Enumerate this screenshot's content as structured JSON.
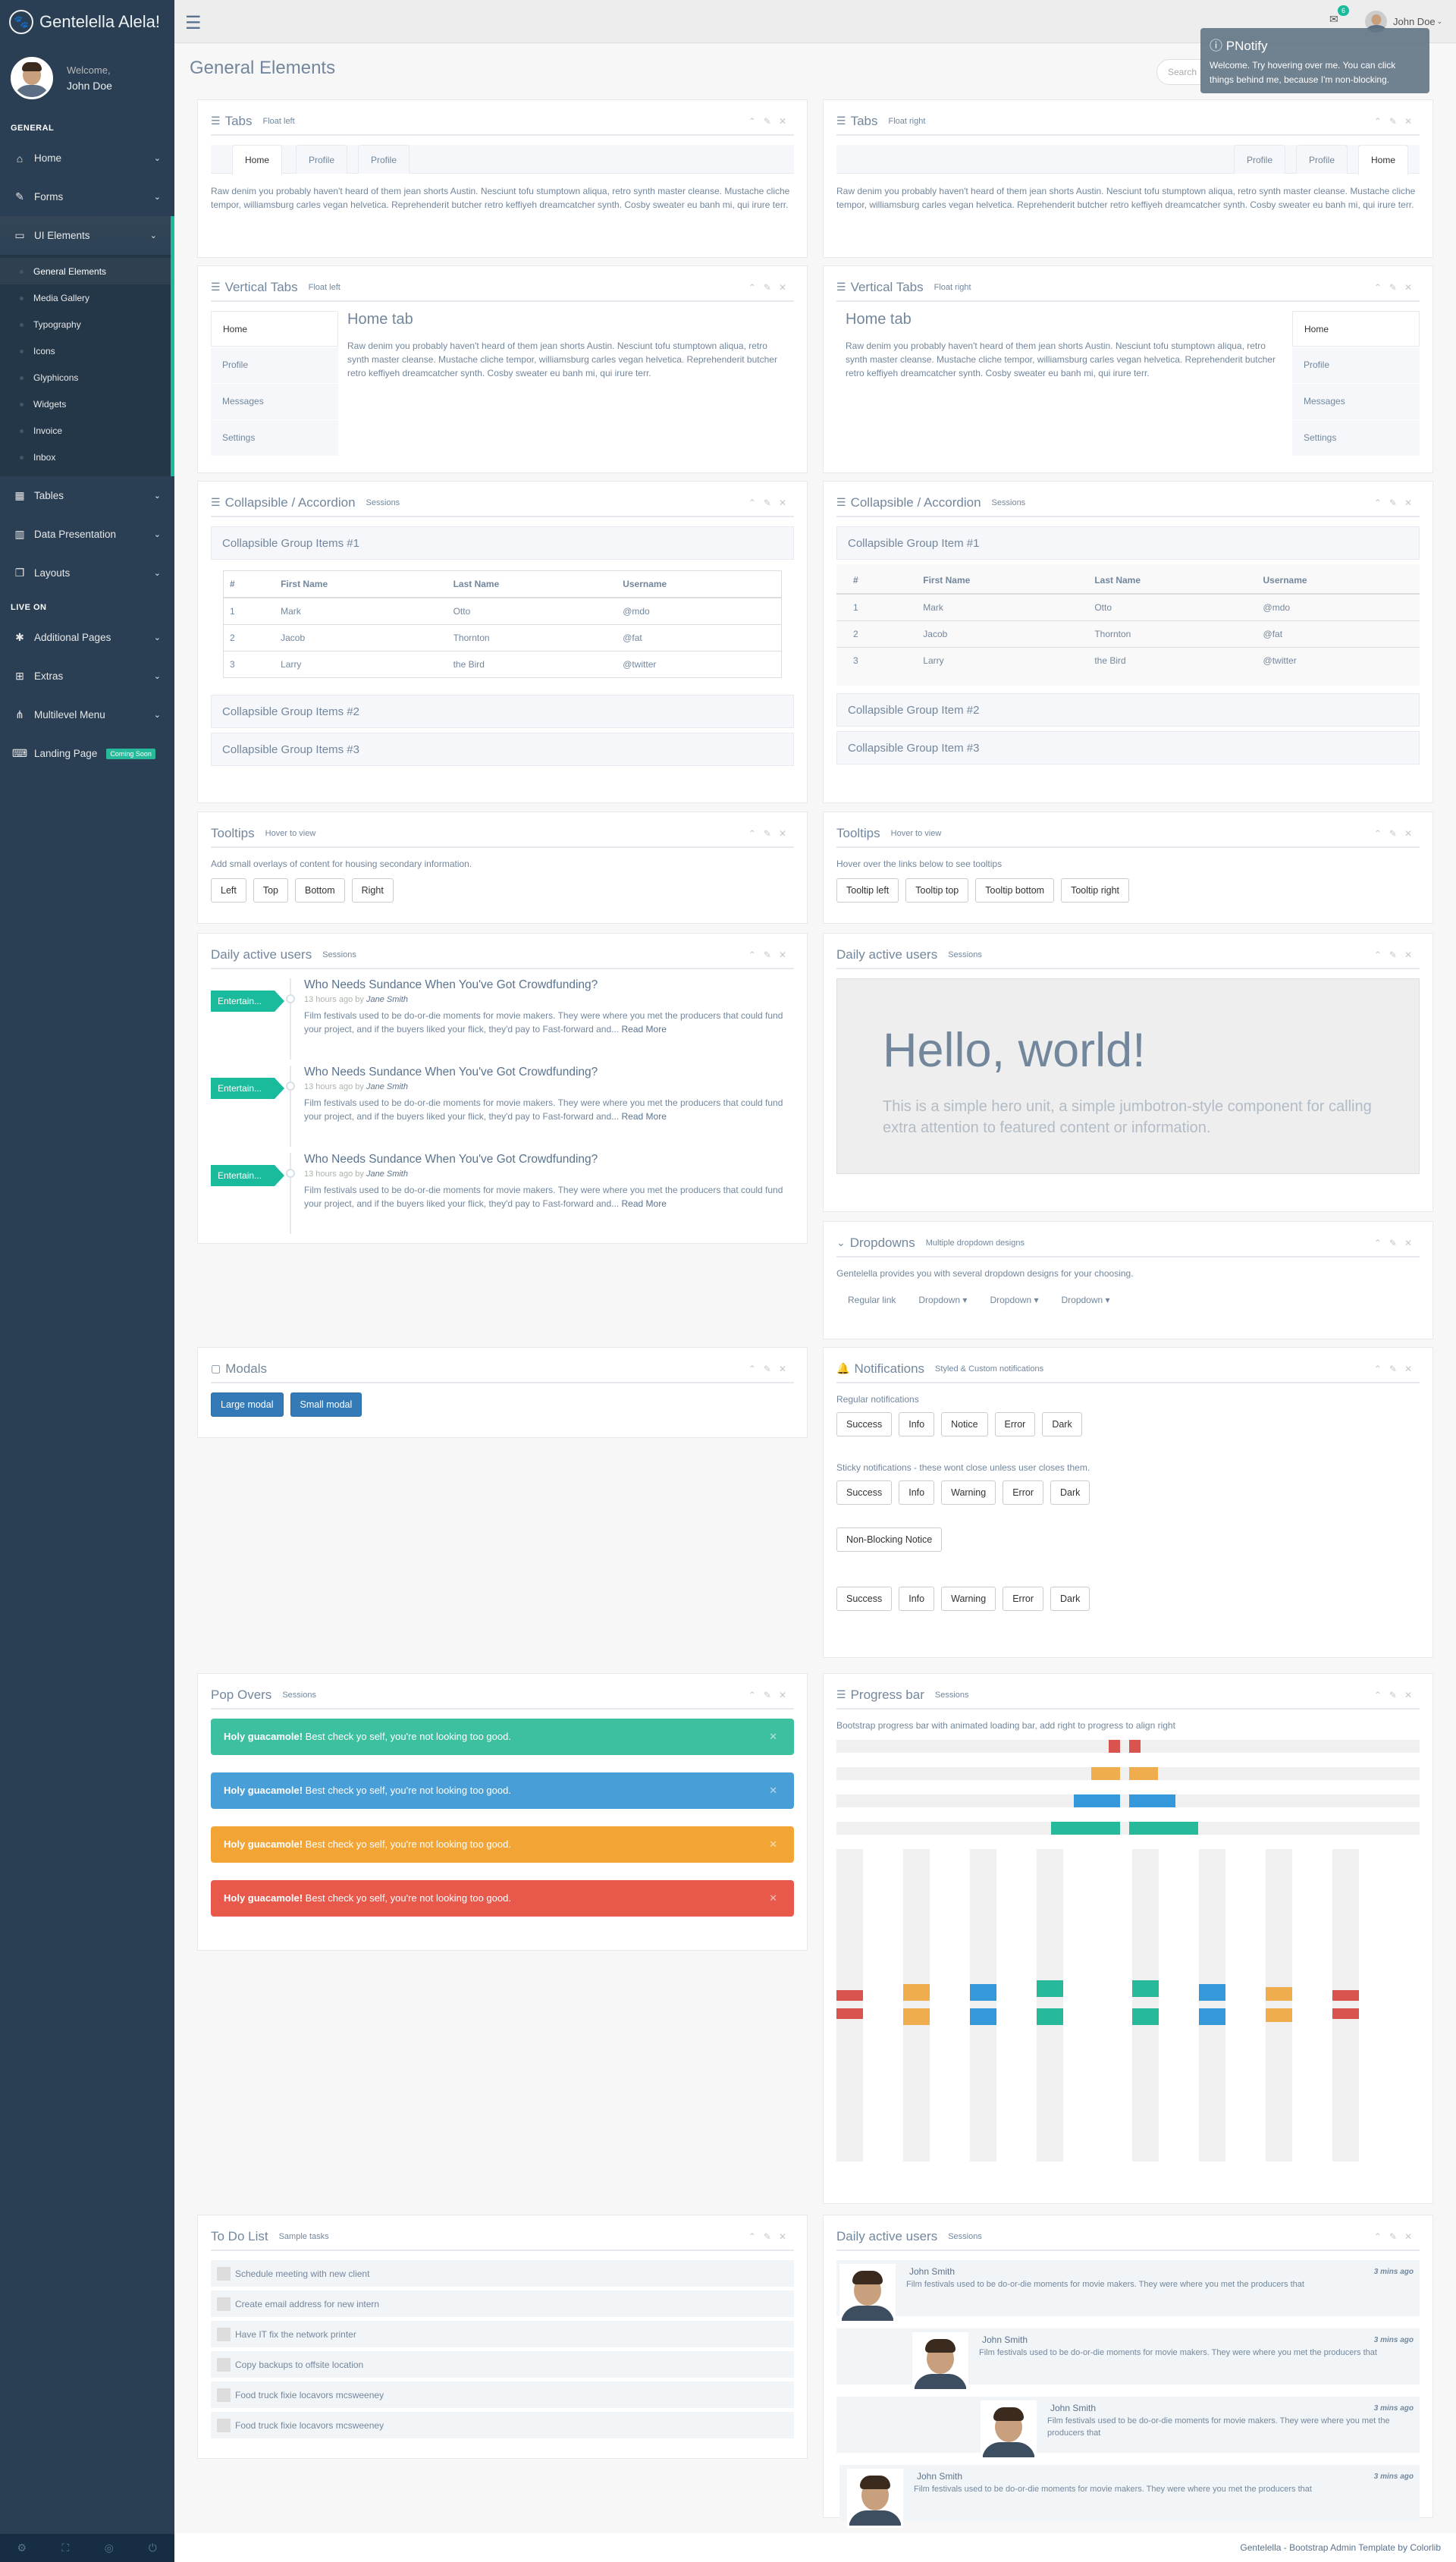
{
  "app": {
    "brand": "Gentelella Alela!",
    "page_title": "General Elements"
  },
  "sidebar": {
    "welcome": "Welcome,",
    "user_name": "John Doe",
    "section_general": "GENERAL",
    "section_live": "LIVE ON",
    "items": [
      {
        "label": "Home",
        "icon": "home-icon"
      },
      {
        "label": "Forms",
        "icon": "edit-icon"
      },
      {
        "label": "UI Elements",
        "icon": "desktop-icon"
      },
      {
        "label": "Tables",
        "icon": "table-icon"
      },
      {
        "label": "Data Presentation",
        "icon": "bar-chart-icon"
      },
      {
        "label": "Layouts",
        "icon": "clone-icon"
      },
      {
        "label": "Additional Pages",
        "icon": "bug-icon"
      },
      {
        "label": "Extras",
        "icon": "windows-icon"
      },
      {
        "label": "Multilevel Menu",
        "icon": "sitemap-icon"
      },
      {
        "label": "Landing Page",
        "icon": "laptop-icon"
      }
    ],
    "submenu": [
      "General Elements",
      "Media Gallery",
      "Typography",
      "Icons",
      "Glyphicons",
      "Widgets",
      "Invoice",
      "Inbox"
    ],
    "coming_soon": "Coming Soon"
  },
  "topnav": {
    "mail_count": "6",
    "user": "John Doe",
    "search_placeholder": "Search"
  },
  "pnotify": {
    "title": "PNotify",
    "body": "Welcome. Try hovering over me. You can click things behind me, because I'm non-blocking."
  },
  "lorem": "Raw denim you probably haven't heard of them jean shorts Austin. Nesciunt tofu stumptown aliqua, retro synth master cleanse. Mustache cliche tempor, williamsburg carles vegan helvetica. Reprehenderit butcher retro keffiyeh dreamcatcher synth. Cosby sweater eu banh mi, qui irure terr.",
  "tabs_left": {
    "title": "Tabs",
    "sub": "Float left",
    "tabs": [
      "Home",
      "Profile",
      "Profile"
    ]
  },
  "tabs_right": {
    "title": "Tabs",
    "sub": "Float right",
    "tabs": [
      "Profile",
      "Profile",
      "Home"
    ]
  },
  "vtabs_left": {
    "title": "Vertical Tabs",
    "sub": "Float left",
    "heading": "Home tab",
    "tabs": [
      "Home",
      "Profile",
      "Messages",
      "Settings"
    ]
  },
  "vtabs_right": {
    "title": "Vertical Tabs",
    "sub": "Float right",
    "heading": "Home tab",
    "tabs": [
      "Home",
      "Profile",
      "Messages",
      "Settings"
    ]
  },
  "acc_left": {
    "title": "Collapsible / Accordion",
    "sub": "Sessions",
    "groups": [
      "Collapsible Group Items #1",
      "Collapsible Group Items #2",
      "Collapsible Group Items #3"
    ]
  },
  "acc_right": {
    "title": "Collapsible / Accordion",
    "sub": "Sessions",
    "groups": [
      "Collapsible Group Item #1",
      "Collapsible Group Item #2",
      "Collapsible Group Item #3"
    ]
  },
  "table": {
    "headers": [
      "#",
      "First Name",
      "Last Name",
      "Username"
    ],
    "rows": [
      [
        "1",
        "Mark",
        "Otto",
        "@mdo"
      ],
      [
        "2",
        "Jacob",
        "Thornton",
        "@fat"
      ],
      [
        "3",
        "Larry",
        "the Bird",
        "@twitter"
      ]
    ]
  },
  "tooltips_left": {
    "title": "Tooltips",
    "sub": "Hover to view",
    "desc": "Add small overlays of content for housing secondary information.",
    "buttons": [
      "Left",
      "Top",
      "Bottom",
      "Right"
    ]
  },
  "tooltips_right": {
    "title": "Tooltips",
    "sub": "Hover to view",
    "desc": "Hover over the links below to see tooltips",
    "buttons": [
      "Tooltip left",
      "Tooltip top",
      "Tooltip bottom",
      "Tooltip right"
    ]
  },
  "timeline": {
    "title": "Daily active users",
    "sub": "Sessions",
    "tag": "Entertain...",
    "item_title": "Who Needs Sundance When You've Got Crowdfunding?",
    "time": "13 hours ago by",
    "author": "Jane Smith",
    "excerpt": "Film festivals used to be do-or-die moments for movie makers. They were where you met the producers that could fund your project, and if the buyers liked your flick, they'd pay to Fast-forward and...",
    "read_more": "Read More"
  },
  "jumbo": {
    "title": "Daily active users",
    "sub": "Sessions",
    "heading": "Hello, world!",
    "text": "This is a simple hero unit, a simple jumbotron-style component for calling extra attention to featured content or information."
  },
  "dropdowns": {
    "title": "Dropdowns",
    "sub": "Multiple dropdown designs",
    "desc": "Gentelella provides you with several dropdown designs for your choosing.",
    "items": [
      "Regular link",
      "Dropdown",
      "Dropdown",
      "Dropdown"
    ]
  },
  "modals": {
    "title": "Modals",
    "buttons": [
      "Large modal",
      "Small modal"
    ]
  },
  "notifications": {
    "title": "Notifications",
    "sub": "Styled & Custom notifications",
    "regular_label": "Regular notifications",
    "regular": [
      "Success",
      "Info",
      "Notice",
      "Error",
      "Dark"
    ],
    "sticky_label": "Sticky notifications - these wont close unless user closes them.",
    "sticky": [
      "Success",
      "Info",
      "Warning",
      "Error",
      "Dark"
    ],
    "nonblocking": "Non-Blocking Notice",
    "extra": [
      "Success",
      "Info",
      "Warning",
      "Error",
      "Dark"
    ]
  },
  "popovers": {
    "title": "Pop Overs",
    "sub": "Sessions",
    "strong": "Holy guacamole!",
    "text": "Best check yo self, you're not looking too good.",
    "colors": [
      "#3DC0A0",
      "#489FD8",
      "#F2A534",
      "#E8594B"
    ]
  },
  "progress": {
    "title": "Progress bar",
    "sub": "Sessions",
    "desc": "Bootstrap progress bar with animated loading bar, add right to  progress to align right",
    "rows": [
      0.02,
      0.05,
      0.08,
      0.12
    ],
    "row_colors": [
      "#D9534F",
      "#F0AD4E",
      "#3498DB",
      "#26B99A"
    ],
    "vbars": [
      0.04,
      0.08,
      0.08,
      0.1,
      0.1,
      0.08,
      0.06,
      0.04
    ],
    "vcolors": [
      "#D9534F",
      "#F0AD4E",
      "#3498DB",
      "#26B99A",
      "#26B99A",
      "#3498DB",
      "#F0AD4E",
      "#D9534F"
    ]
  },
  "todo": {
    "title": "To Do List",
    "sub": "Sample tasks",
    "items": [
      "Schedule meeting with new client",
      "Create email address for new intern",
      "Have IT fix the network printer",
      "Copy backups to offsite location",
      "Food truck fixie locavors mcsweeney",
      "Food truck fixie locavors mcsweeney"
    ]
  },
  "messages": {
    "title": "Daily active users",
    "sub": "Sessions",
    "name": "John Smith",
    "time": "3 mins ago",
    "text": "Film festivals used to be do-or-die moments for movie makers. They were where you met the producers that"
  },
  "footer": {
    "text": "Gentelella - Bootstrap Admin Template by ",
    "link": "Colorlib"
  }
}
